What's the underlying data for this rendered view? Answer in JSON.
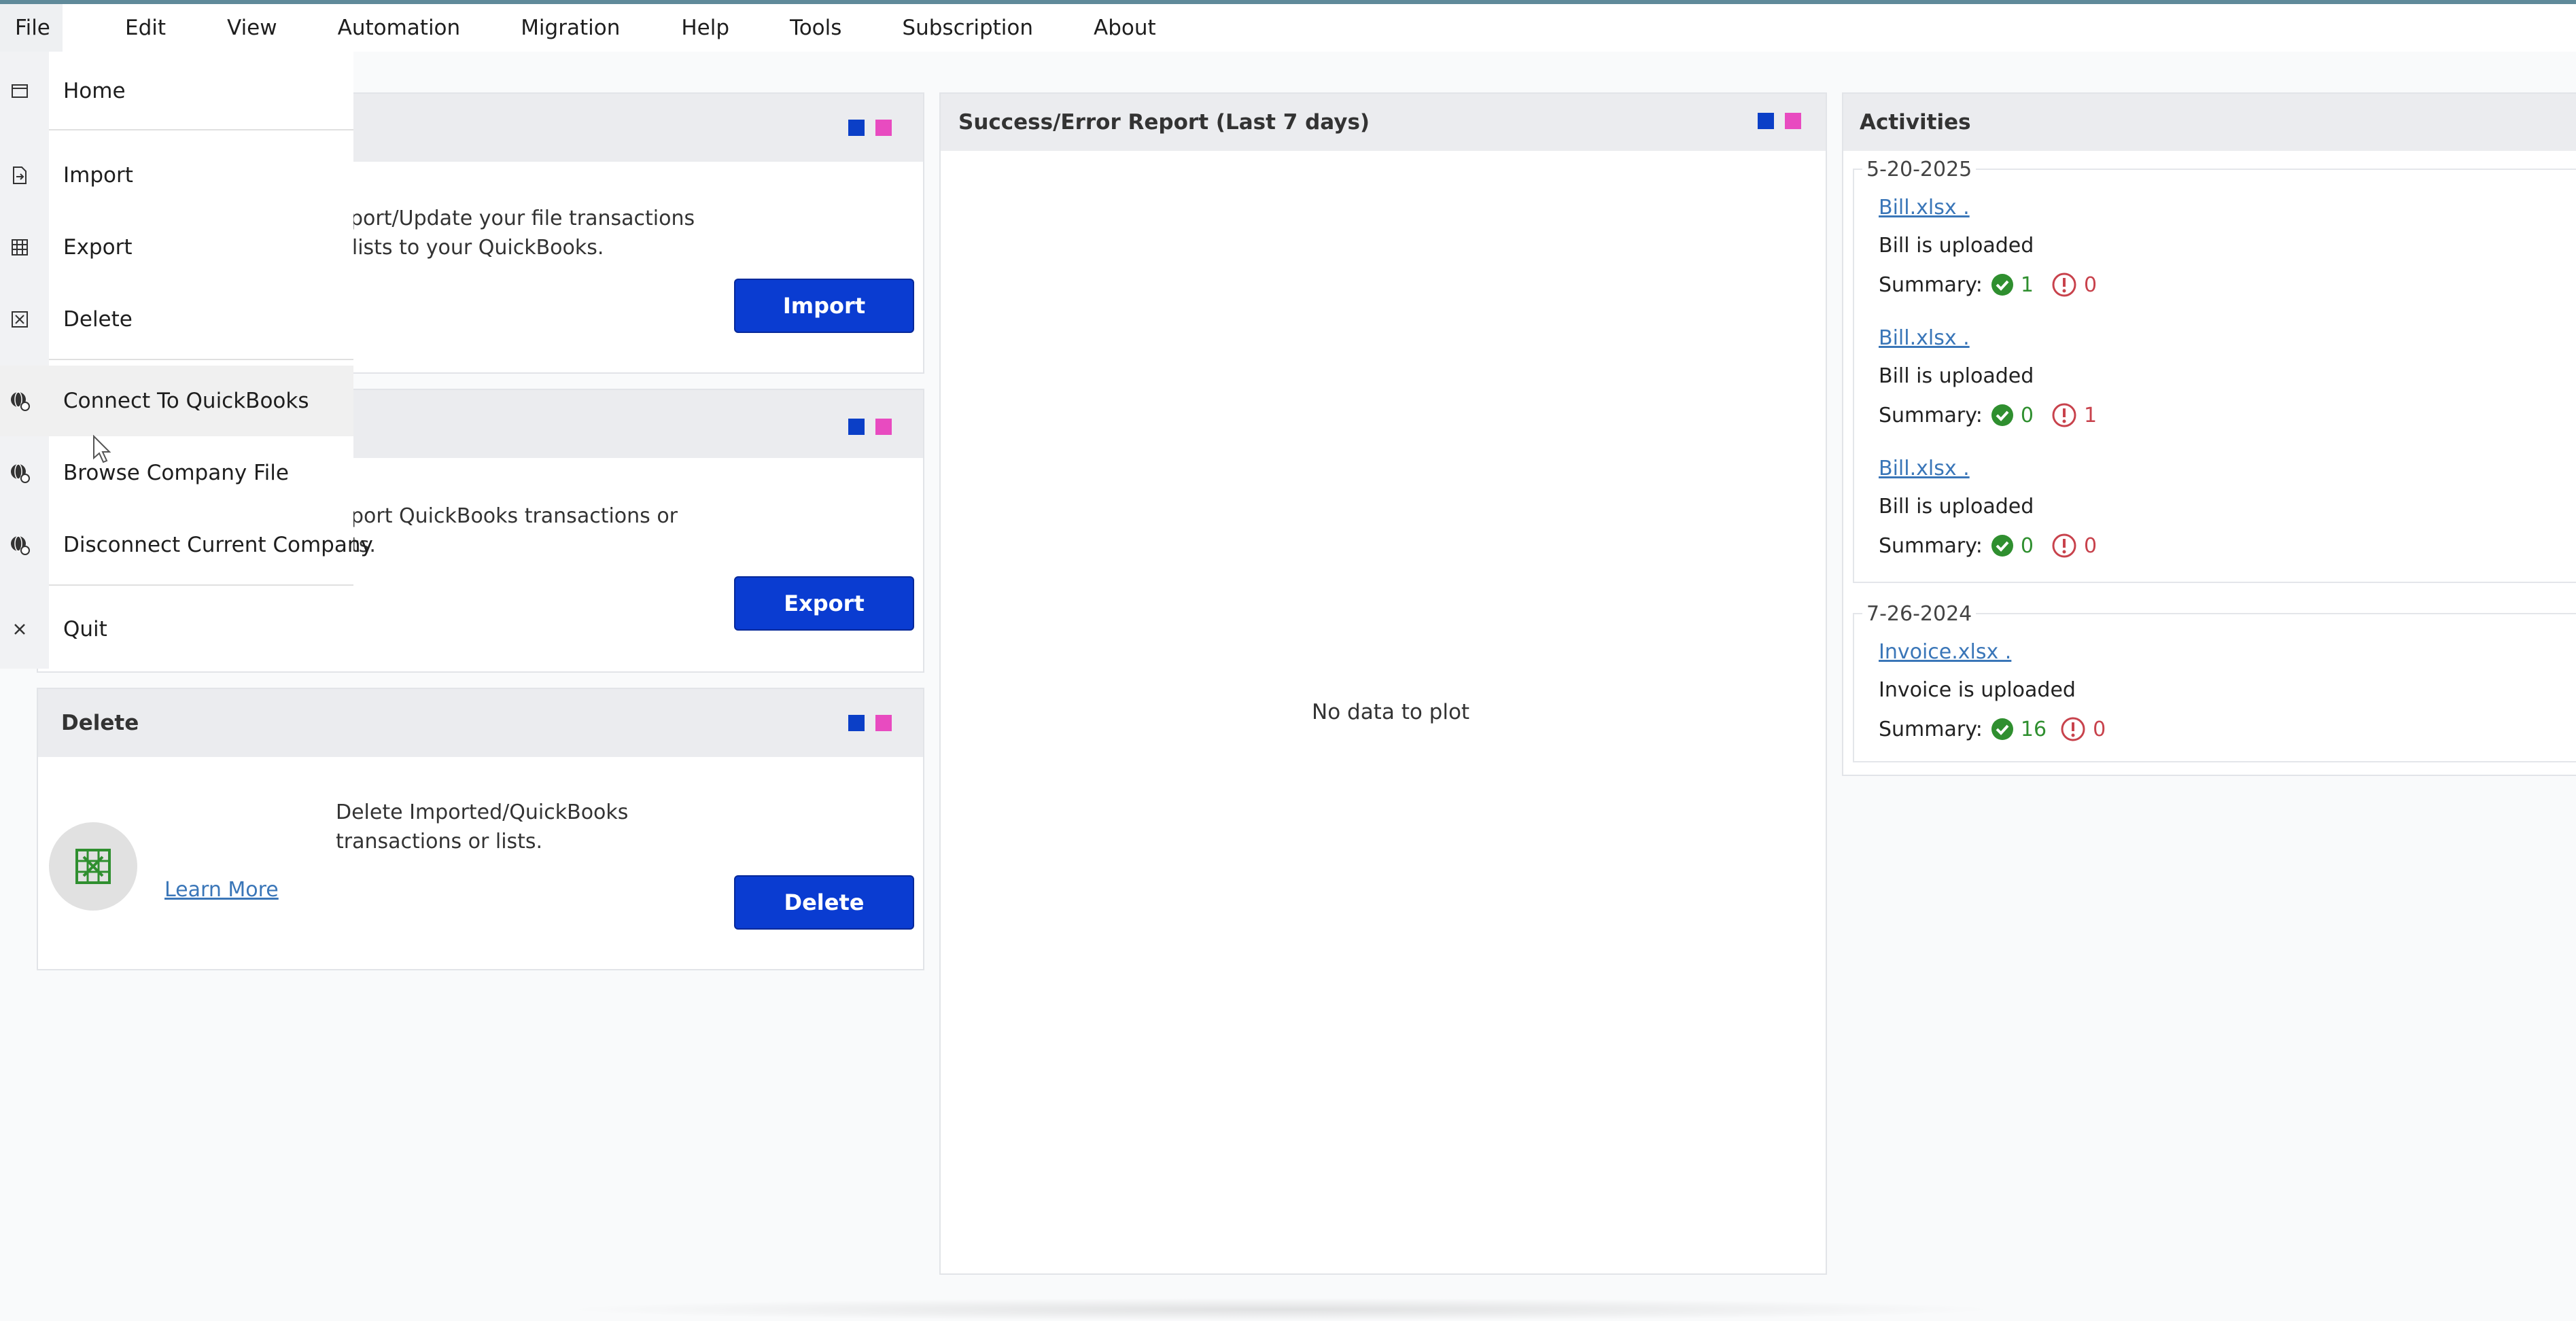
{
  "menubar": {
    "items": [
      "File",
      "Edit",
      "View",
      "Automation",
      "Migration",
      "Help",
      "Tools",
      "Subscription",
      "About"
    ]
  },
  "file_menu": {
    "items": [
      {
        "label": "Home",
        "icon": "window-icon"
      },
      {
        "label": "Import",
        "icon": "file-import-icon"
      },
      {
        "label": "Export",
        "icon": "table-icon"
      },
      {
        "label": "Delete",
        "icon": "grid-delete-icon"
      },
      {
        "label": "Connect To QuickBooks",
        "icon": "globe-link-icon"
      },
      {
        "label": "Browse Company File",
        "icon": "globe-link-icon"
      },
      {
        "label": "Disconnect Current Company",
        "icon": "globe-link-icon"
      },
      {
        "label": "Quit",
        "icon": "close-icon"
      }
    ]
  },
  "import_card": {
    "description_line1": "nport/Update your file transactions",
    "description_line2": "r lists to your QuickBooks.",
    "button": "Import"
  },
  "export_card": {
    "description_line1": "port QuickBooks transactions or",
    "description_line2": "ts.",
    "button": "Export"
  },
  "delete_card": {
    "title": "Delete",
    "description_line1": "Delete Imported/QuickBooks",
    "description_line2": "transactions or lists.",
    "learn_more": "Learn More",
    "button": "Delete"
  },
  "report": {
    "title": "Success/Error Report (Last 7 days)",
    "empty_text": "No data to plot"
  },
  "activities": {
    "title": "Activities",
    "summary_label": "Summary:",
    "groups": [
      {
        "date": "5-20-2025",
        "entries": [
          {
            "file": "Bill.xlsx .",
            "status": "Bill is uploaded",
            "success": "1",
            "error": "0"
          },
          {
            "file": "Bill.xlsx .",
            "status": "Bill is uploaded",
            "success": "0",
            "error": "1"
          },
          {
            "file": "Bill.xlsx .",
            "status": "Bill is uploaded",
            "success": "0",
            "error": "0"
          }
        ]
      },
      {
        "date": "7-26-2024",
        "entries": [
          {
            "file": "Invoice.xlsx .",
            "status": "Invoice is uploaded",
            "success": "16",
            "error": "0"
          }
        ]
      }
    ]
  },
  "colors": {
    "primary_button": "#0a3cd1",
    "indicator_blue": "#0b3fc7",
    "indicator_pink": "#e84bc0",
    "success": "#2f8f2f",
    "error": "#c8424c",
    "link": "#3a76b8"
  }
}
